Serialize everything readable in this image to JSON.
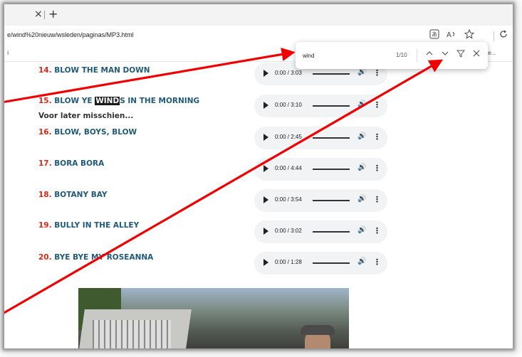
{
  "browser": {
    "tab_close": "×",
    "tab_new": "+",
    "url": "e/wind%20nieuw/wsleden/paginas/MP3.html",
    "bookmark_left": "i",
    "bookmark_right": "rbe..."
  },
  "find": {
    "query": "wind",
    "count": "1/10",
    "prev_icon": "chevron-up",
    "next_icon": "chevron-down",
    "filter_icon": "filter",
    "close_icon": "close"
  },
  "songs": [
    {
      "num": "14.",
      "title": "BLOW THE MAN DOWN",
      "time": "0:00 / 3:03"
    },
    {
      "num": "15.",
      "title_pre": "BLOW YE ",
      "title_hl": "WIND",
      "title_post": "S IN THE MORNING",
      "time": "0:00 / 3:10",
      "note": "Voor later misschien..."
    },
    {
      "num": "16.",
      "title": "BLOW, BOYS, BLOW",
      "time": "0:00 / 2:45"
    },
    {
      "num": "17.",
      "title": "BORA BORA",
      "time": "0:00 / 4:44"
    },
    {
      "num": "18.",
      "title": "BOTANY BAY",
      "time": "0:00 / 3:54"
    },
    {
      "num": "19.",
      "title": "BULLY IN THE ALLEY",
      "time": "0:00 / 3:02"
    },
    {
      "num": "20.",
      "title": "BYE BYE MY ROSEANNA",
      "time": "0:00 / 1:28"
    }
  ],
  "colors": {
    "song_number": "#d8281b",
    "song_title": "#1f5a7a",
    "highlight": "#f5a623",
    "annotation_arrow": "#ee0000"
  }
}
